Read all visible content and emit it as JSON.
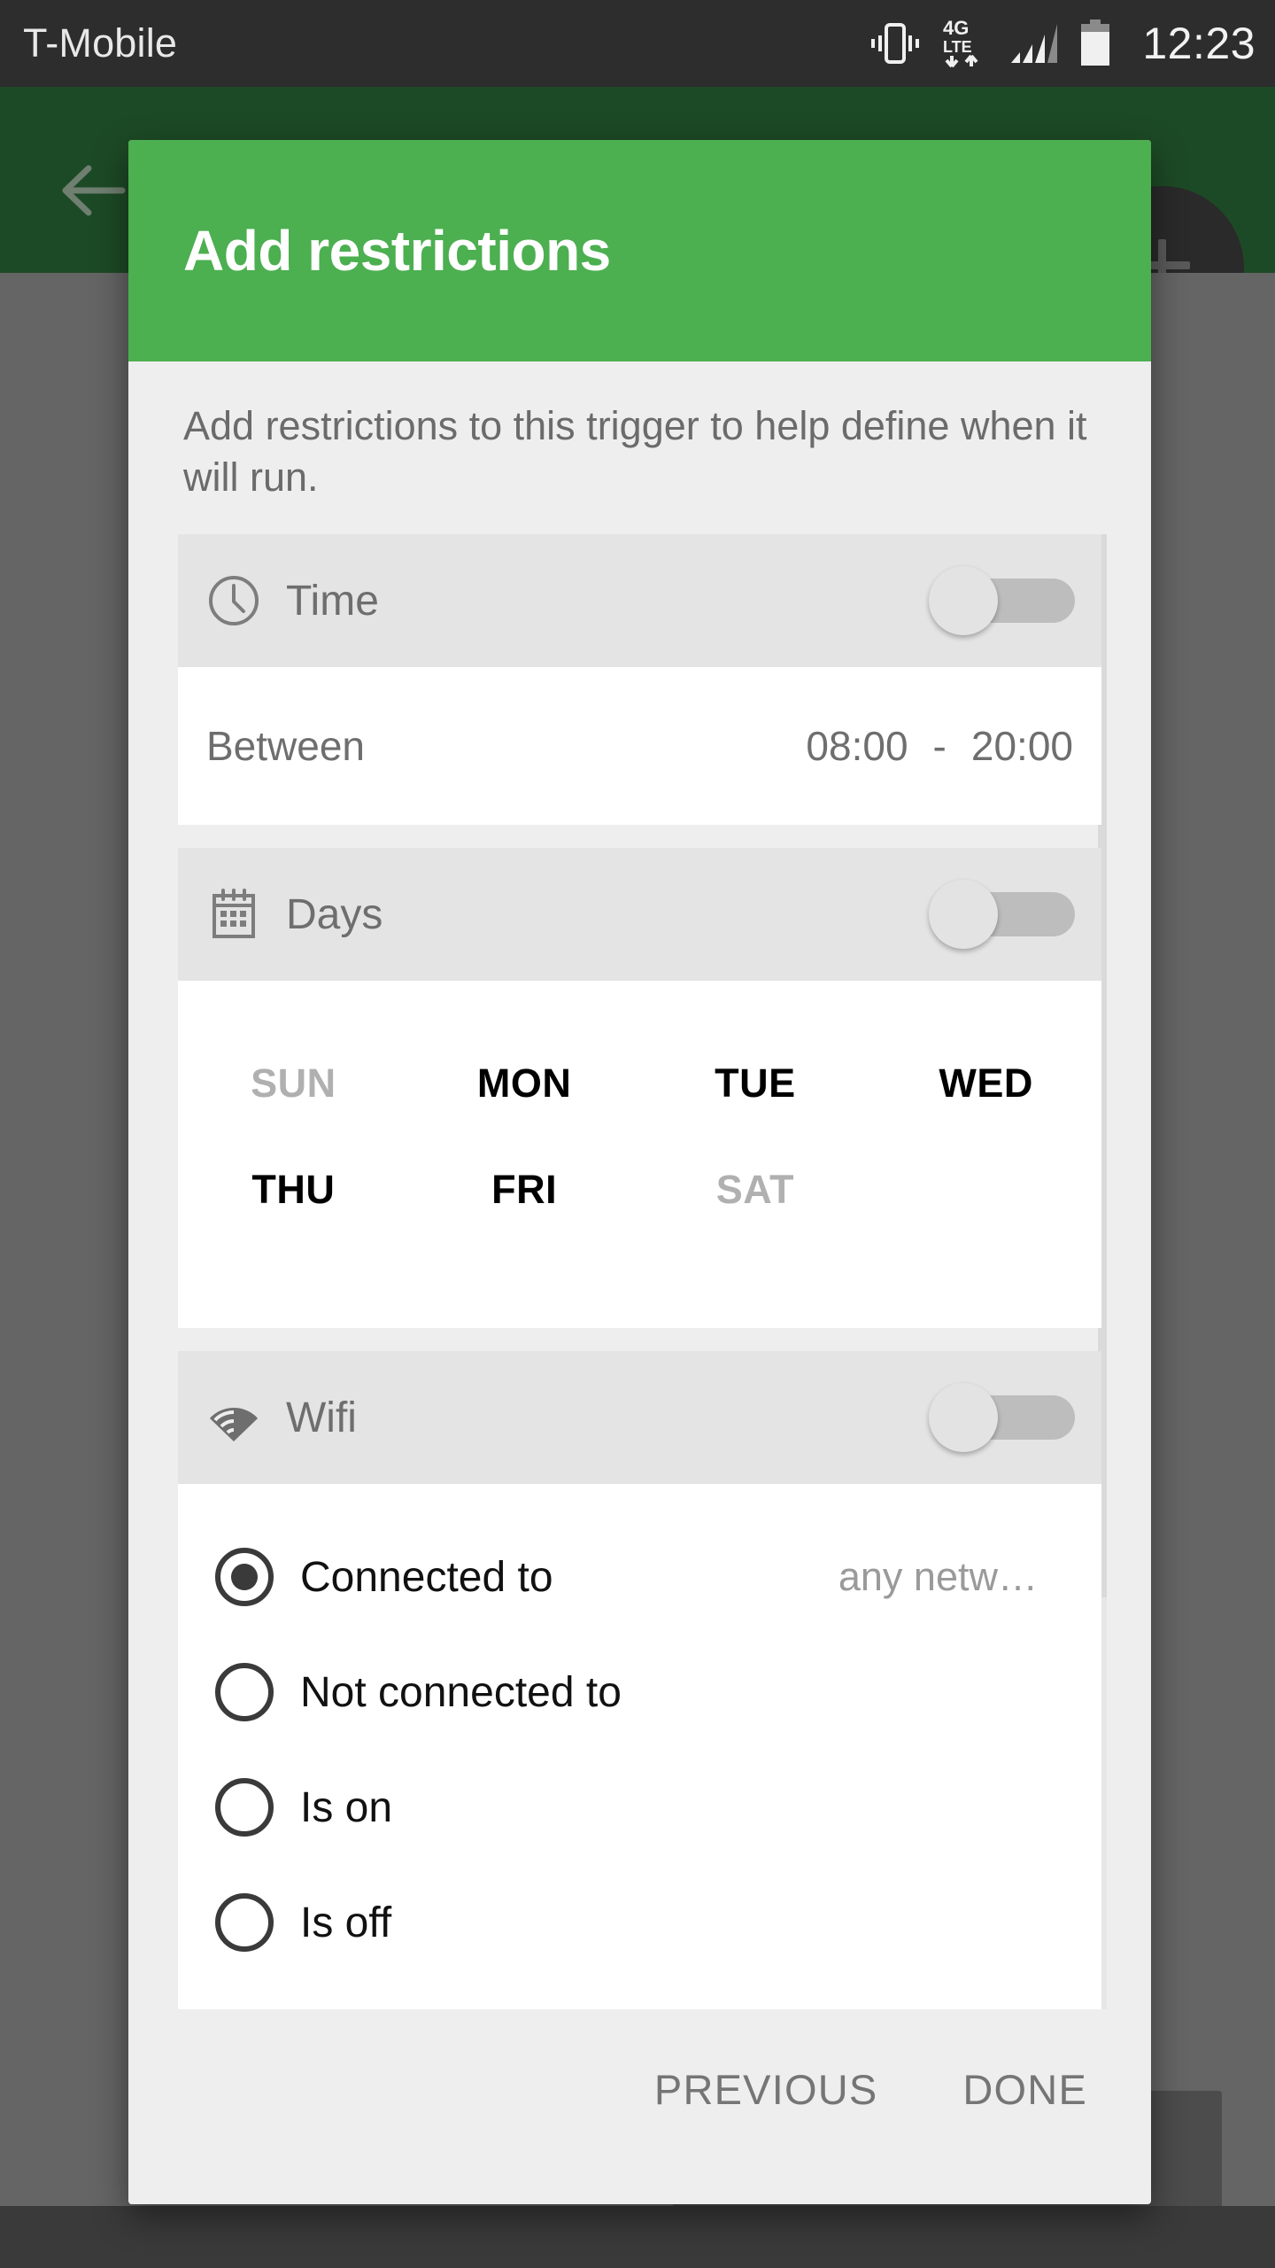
{
  "status_bar": {
    "carrier": "T-Mobile",
    "time": "12:23",
    "icons": [
      "vibrate-icon",
      "4g-lte-icon",
      "signal-bars-icon",
      "battery-icon"
    ],
    "network_label_top": "4G",
    "network_label_bottom": "LTE"
  },
  "background": {
    "back_icon": "back-arrow-icon",
    "fab_icon": "plus-icon",
    "appbar_color": "#1d4a26",
    "scrim_color": "#656565"
  },
  "dialog": {
    "title": "Add restrictions",
    "header_color": "#4CAF50",
    "description": "Add restrictions to this trigger to help define when it will run.",
    "sections": [
      {
        "id": "time",
        "icon": "clock-icon",
        "label": "Time",
        "toggle_state": "off",
        "row_label": "Between",
        "start_time": "08:00",
        "separator": "-",
        "end_time": "20:00"
      },
      {
        "id": "days",
        "icon": "calendar-icon",
        "label": "Days",
        "toggle_state": "off",
        "days": [
          {
            "label": "SUN",
            "selected": false
          },
          {
            "label": "MON",
            "selected": true
          },
          {
            "label": "TUE",
            "selected": true
          },
          {
            "label": "WED",
            "selected": true
          },
          {
            "label": "THU",
            "selected": true
          },
          {
            "label": "FRI",
            "selected": true
          },
          {
            "label": "SAT",
            "selected": false
          }
        ]
      },
      {
        "id": "wifi",
        "icon": "wifi-icon",
        "label": "Wifi",
        "toggle_state": "off",
        "options": [
          {
            "label": "Connected to",
            "selected": true,
            "value": "any netw…"
          },
          {
            "label": "Not connected to",
            "selected": false,
            "value": ""
          },
          {
            "label": "Is on",
            "selected": false,
            "value": ""
          },
          {
            "label": "Is off",
            "selected": false,
            "value": ""
          }
        ]
      }
    ],
    "footer": {
      "previous_label": "PREVIOUS",
      "done_label": "DONE"
    }
  }
}
